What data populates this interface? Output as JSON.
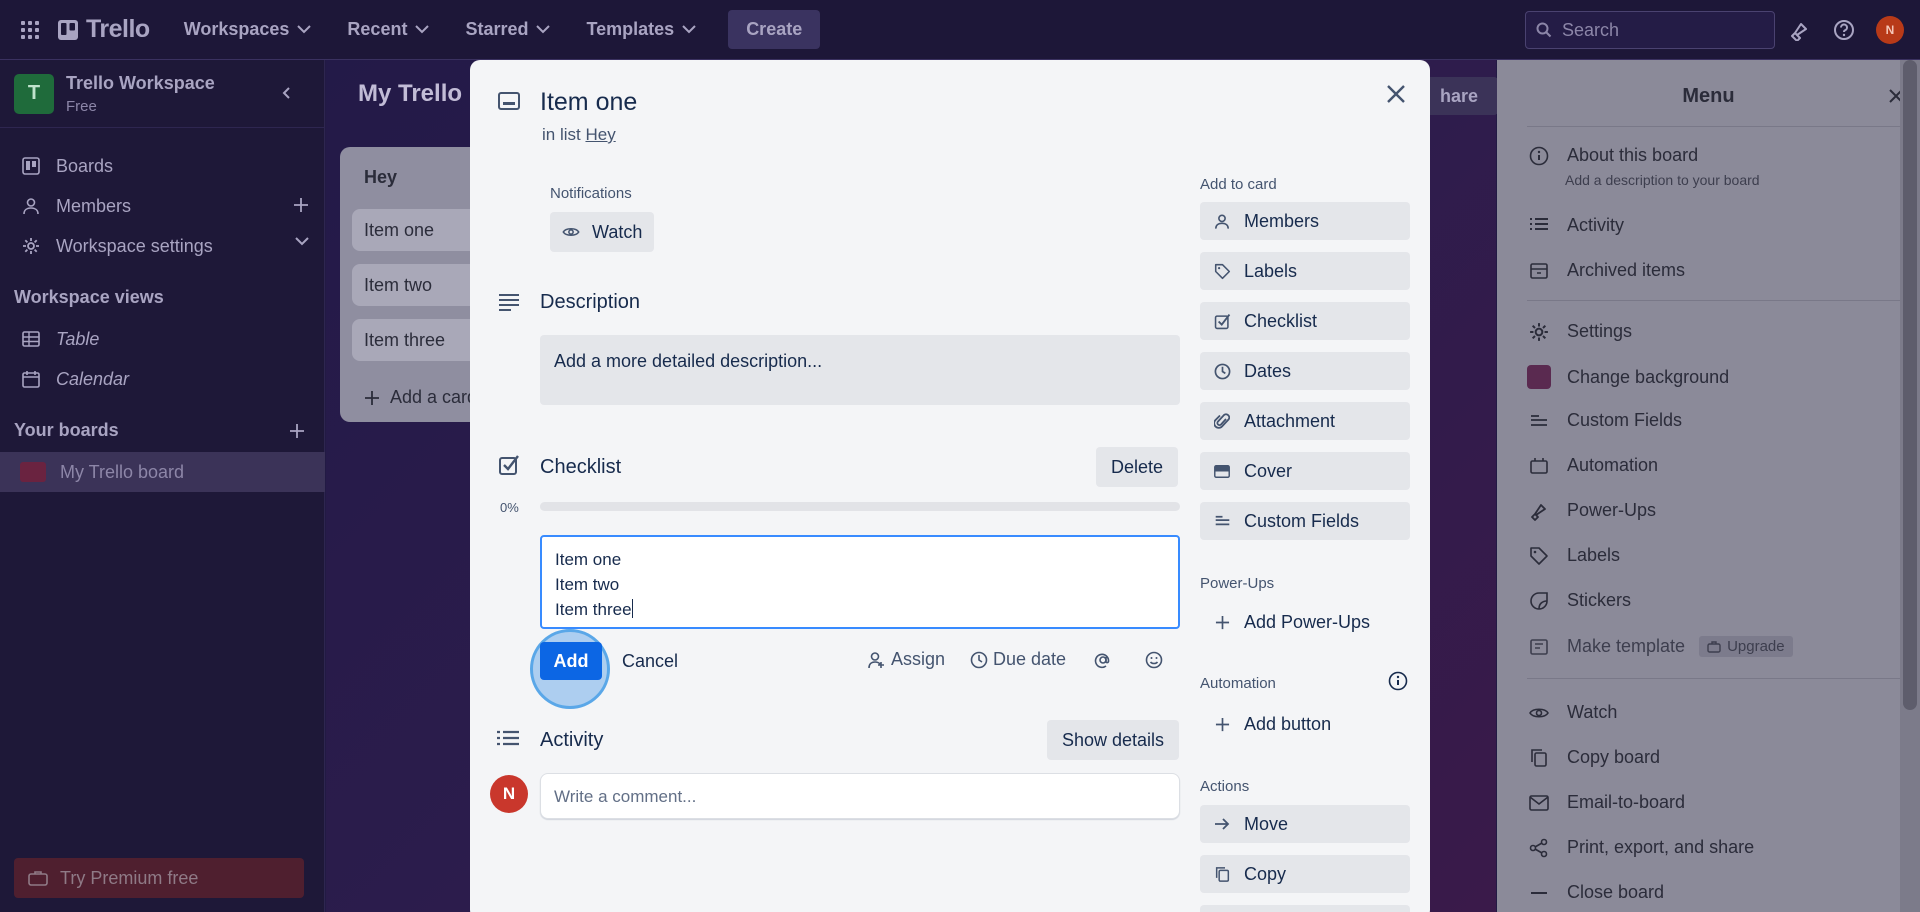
{
  "topbar": {
    "logo": "Trello",
    "nav": [
      {
        "label": "Workspaces"
      },
      {
        "label": "Recent"
      },
      {
        "label": "Starred"
      },
      {
        "label": "Templates"
      }
    ],
    "create_label": "Create",
    "search_placeholder": "Search",
    "avatar_initial": "N"
  },
  "sidebar": {
    "workspace_initial": "T",
    "workspace_name": "Trello Workspace",
    "workspace_plan": "Free",
    "items": [
      {
        "label": "Boards",
        "icon": "trello-board-icon"
      },
      {
        "label": "Members",
        "icon": "person-icon"
      },
      {
        "label": "Workspace settings",
        "icon": "gear-icon"
      }
    ],
    "views_heading": "Workspace views",
    "views": [
      {
        "label": "Table",
        "icon": "table-icon"
      },
      {
        "label": "Calendar",
        "icon": "calendar-icon"
      }
    ],
    "your_boards_heading": "Your boards",
    "boards": [
      {
        "label": "My Trello board"
      }
    ],
    "premium_label": "Try Premium free"
  },
  "board": {
    "title": "My Trello board",
    "title_visible": "My Trello b",
    "share_label": "Share",
    "share_visible": "hare",
    "list": {
      "title": "Hey",
      "cards": [
        "Item one",
        "Item two",
        "Item three"
      ],
      "add_card_label": "Add a card",
      "add_card_visible": "Add a card"
    }
  },
  "menu": {
    "title": "Menu",
    "items": [
      {
        "label": "About this board",
        "sub": "Add a description to your board",
        "icon": "info-icon"
      },
      {
        "label": "Activity",
        "icon": "activity-icon"
      },
      {
        "label": "Archived items",
        "icon": "archive-icon"
      },
      {
        "label": "Settings",
        "icon": "gear-icon"
      },
      {
        "label": "Change background",
        "icon": "background-swatch"
      },
      {
        "label": "Custom Fields",
        "icon": "custom-fields-icon"
      },
      {
        "label": "Automation",
        "icon": "automation-icon"
      },
      {
        "label": "Power-Ups",
        "icon": "rocket-icon"
      },
      {
        "label": "Labels",
        "icon": "tag-icon"
      },
      {
        "label": "Stickers",
        "icon": "sticker-icon"
      },
      {
        "label": "Make template",
        "icon": "template-icon",
        "badge": "Upgrade"
      },
      {
        "label": "Watch",
        "icon": "eye-icon"
      },
      {
        "label": "Copy board",
        "icon": "copy-icon"
      },
      {
        "label": "Email-to-board",
        "icon": "mail-icon"
      },
      {
        "label": "Print, export, and share",
        "icon": "share-icon"
      },
      {
        "label": "Close board",
        "icon": "minus-icon"
      }
    ]
  },
  "modal": {
    "title": "Item one",
    "in_list_prefix": "in list",
    "in_list_name": "Hey",
    "notifications_label": "Notifications",
    "watch_label": "Watch",
    "description_heading": "Description",
    "description_placeholder": "Add a more detailed description...",
    "checklist_heading": "Checklist",
    "delete_label": "Delete",
    "progress_label": "0%",
    "progress_value": 0,
    "checklist_input_lines": [
      "Item one",
      "Item two",
      "Item three"
    ],
    "add_label": "Add",
    "cancel_label": "Cancel",
    "assign_label": "Assign",
    "due_date_label": "Due date",
    "activity_heading": "Activity",
    "show_details_label": "Show details",
    "comment_avatar_initial": "N",
    "comment_placeholder": "Write a comment...",
    "add_to_card_heading": "Add to card",
    "add_to_card": [
      {
        "label": "Members",
        "icon": "person-icon"
      },
      {
        "label": "Labels",
        "icon": "tag-icon"
      },
      {
        "label": "Checklist",
        "icon": "checklist-icon"
      },
      {
        "label": "Dates",
        "icon": "clock-icon"
      },
      {
        "label": "Attachment",
        "icon": "paperclip-icon"
      },
      {
        "label": "Cover",
        "icon": "cover-icon"
      },
      {
        "label": "Custom Fields",
        "icon": "custom-fields-icon"
      }
    ],
    "powerups_heading": "Power-Ups",
    "add_powerups_label": "Add Power-Ups",
    "automation_heading": "Automation",
    "add_button_label": "Add button",
    "actions_heading": "Actions",
    "actions": [
      {
        "label": "Move",
        "icon": "arrow-right-icon"
      },
      {
        "label": "Copy",
        "icon": "copy-icon"
      }
    ]
  }
}
